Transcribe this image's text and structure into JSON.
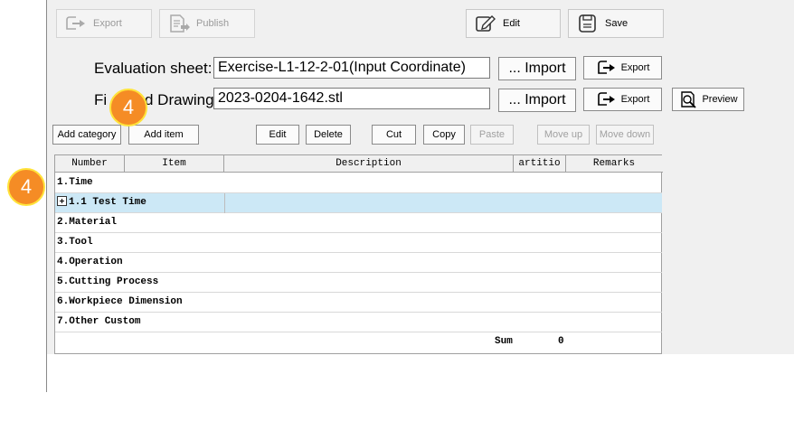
{
  "toolbar": {
    "export_label": "Export",
    "publish_label": "Publish",
    "edit_label": "Edit",
    "save_label": "Save"
  },
  "evaluation": {
    "label": "Evaluation sheet:",
    "value": "Exercise-L1-12-2-01(Input Coordinate)",
    "import_label": "... Import",
    "export_label": "Export"
  },
  "drawing": {
    "label_left": "Fi",
    "label_right": "d Drawing:",
    "value": "2023-0204-1642.stl",
    "import_label": "... Import",
    "export_label": "Export",
    "preview_label": "Preview"
  },
  "actions": {
    "add_category": "Add category",
    "add_item": "Add item",
    "edit": "Edit",
    "delete": "Delete",
    "cut": "Cut",
    "copy": "Copy",
    "paste": "Paste",
    "move_up": "Move up",
    "move_down": "Move down"
  },
  "table": {
    "columns": [
      "Number",
      "Item",
      "Description",
      "artitio",
      "Remarks"
    ],
    "rows": [
      "1.Time",
      "1.1 Test Time",
      "2.Material",
      "3.Tool",
      "4.Operation",
      "5.Cutting Process",
      "6.Workpiece Dimension",
      "7.Other Custom"
    ],
    "sum_label": "Sum",
    "sum_value": "0"
  },
  "badges": {
    "step_top": "4",
    "step_left": "4"
  },
  "colors": {
    "badge_fill": "#f58c25",
    "badge_ring": "#ffe33a",
    "selected_row": "#cce8f6"
  }
}
